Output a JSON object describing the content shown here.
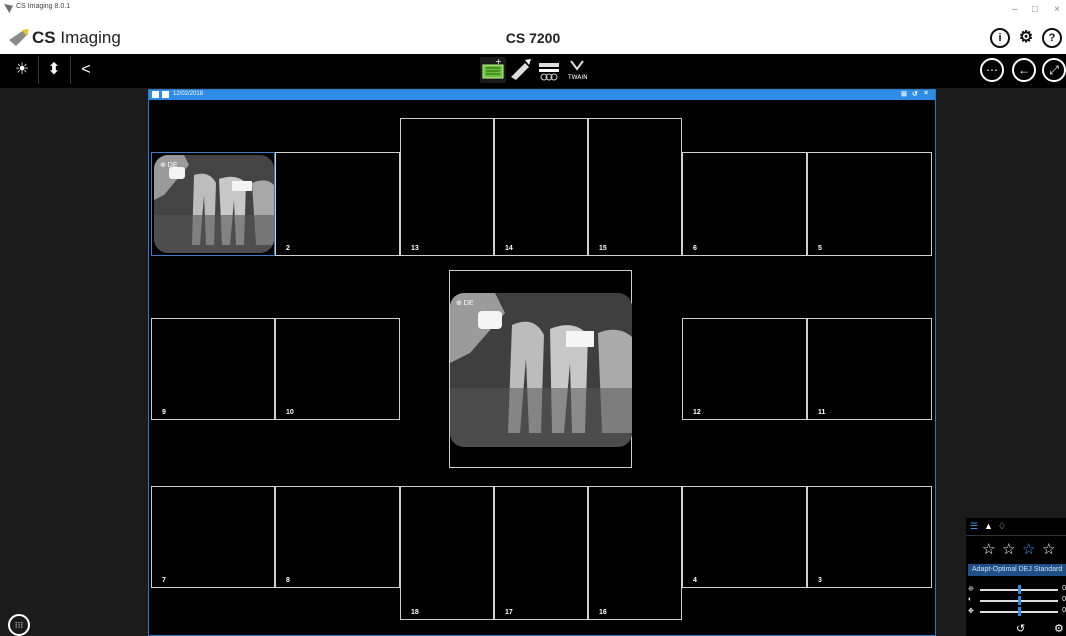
{
  "window": {
    "title": "CS Imaging 8.0.1",
    "controls": [
      "–",
      "□",
      "×"
    ]
  },
  "header": {
    "logo_bold": "CS",
    "logo_rest": " Imaging",
    "device": "CS 7200",
    "icons": [
      "info-icon",
      "settings-gear-icon",
      "help-icon"
    ]
  },
  "toolbar": {
    "left": [
      {
        "name": "brightness-icon",
        "glyph": "☀"
      },
      {
        "name": "paint-bucket-icon",
        "glyph": "⬍"
      },
      {
        "name": "share-icon",
        "glyph": "<"
      }
    ],
    "right": [
      {
        "name": "more-options-icon",
        "glyph": "⋯"
      },
      {
        "name": "back-arrow-icon",
        "glyph": "←"
      },
      {
        "name": "fullscreen-icon",
        "glyph": "⤢"
      }
    ],
    "acquisition_accent": "#7fd23c"
  },
  "exam": {
    "date": "12/02/2018",
    "bar_color": "#2e8be6"
  },
  "slots": {
    "s1_label": "⊕ DE",
    "n2": "2",
    "n13": "13",
    "n14": "14",
    "n15": "15",
    "n6": "6",
    "n5": "5",
    "n9": "9",
    "n10": "10",
    "n12": "12",
    "n11": "11",
    "n7": "7",
    "n8": "8",
    "n18": "18",
    "n17": "17",
    "n16": "16",
    "n4": "4",
    "n3": "3",
    "center_label": "⊕ DE"
  },
  "panel": {
    "filter": "Adapt-Optimal DEJ Standard",
    "stars_count": 4,
    "active_star": 3,
    "sliders": [
      {
        "icon": "sharpness-icon",
        "value": "0",
        "level": 0.5
      },
      {
        "icon": "contrast-icon",
        "value": "0",
        "level": 0.5
      },
      {
        "icon": "noise-icon",
        "value": "0",
        "level": 0.5
      }
    ],
    "reset_glyph": "↺",
    "settings_glyph": "⚙"
  }
}
